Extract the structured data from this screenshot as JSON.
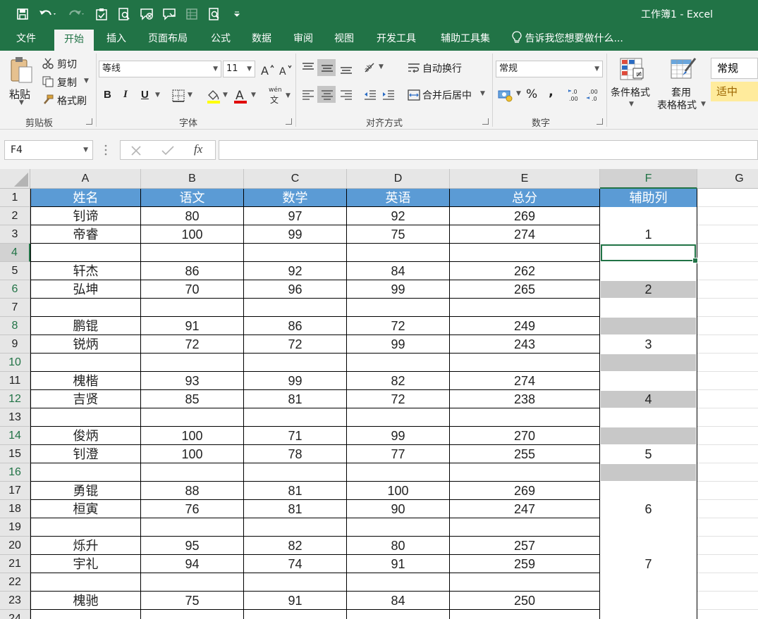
{
  "window": {
    "title": "工作簿1 - Excel"
  },
  "tabs": [
    {
      "label": "文件",
      "active": false
    },
    {
      "label": "开始",
      "active": true
    },
    {
      "label": "插入",
      "active": false
    },
    {
      "label": "页面布局",
      "active": false
    },
    {
      "label": "公式",
      "active": false
    },
    {
      "label": "数据",
      "active": false
    },
    {
      "label": "审阅",
      "active": false
    },
    {
      "label": "视图",
      "active": false
    },
    {
      "label": "开发工具",
      "active": false
    },
    {
      "label": "辅助工具集",
      "active": false
    }
  ],
  "tell_me": "告诉我您想要做什么...",
  "ribbon": {
    "clipboard": {
      "paste": "粘贴",
      "cut": "剪切",
      "copy": "复制",
      "format_painter": "格式刷",
      "label": "剪贴板"
    },
    "font": {
      "name": "等线",
      "size": "11",
      "label": "字体",
      "bold": "B",
      "italic": "I",
      "underline": "U",
      "wen": "wén",
      "wen_char": "文"
    },
    "alignment": {
      "wrap": "自动换行",
      "merge": "合并后居中",
      "label": "对齐方式"
    },
    "number": {
      "format": "常规",
      "label": "数字",
      "percent": "%",
      "comma": ","
    },
    "styles": {
      "conditional": "条件格式",
      "table_line1": "套用",
      "table_line2": "表格格式",
      "normal": "常规",
      "neutral": "适中"
    }
  },
  "formula_bar": {
    "name_box": "F4",
    "fx": "fx",
    "formula": ""
  },
  "sheet": {
    "columns": [
      "A",
      "B",
      "C",
      "D",
      "E",
      "F",
      "G"
    ],
    "selected_column": "F",
    "selected_row": 4,
    "active_cell": "F4",
    "header_row": [
      "姓名",
      "语文",
      "数学",
      "英语",
      "总分"
    ],
    "helper_header": "辅助列",
    "rows": [
      {
        "n": 2,
        "cells": [
          "钊谛",
          "80",
          "97",
          "92",
          "269"
        ],
        "f": "",
        "gray": false
      },
      {
        "n": 3,
        "cells": [
          "帝睿",
          "100",
          "99",
          "75",
          "274"
        ],
        "f": "1",
        "gray": false
      },
      {
        "n": 4,
        "cells": [
          "",
          "",
          "",
          "",
          ""
        ],
        "f": "",
        "gray": false
      },
      {
        "n": 5,
        "cells": [
          "轩杰",
          "86",
          "92",
          "84",
          "262"
        ],
        "f": "",
        "gray": false
      },
      {
        "n": 6,
        "cells": [
          "弘坤",
          "70",
          "96",
          "99",
          "265"
        ],
        "f": "2",
        "gray": true
      },
      {
        "n": 7,
        "cells": [
          "",
          "",
          "",
          "",
          ""
        ],
        "f": "",
        "gray": false
      },
      {
        "n": 8,
        "cells": [
          "鹏锟",
          "91",
          "86",
          "72",
          "249"
        ],
        "f": "",
        "gray": true
      },
      {
        "n": 9,
        "cells": [
          "锐炳",
          "72",
          "72",
          "99",
          "243"
        ],
        "f": "3",
        "gray": false
      },
      {
        "n": 10,
        "cells": [
          "",
          "",
          "",
          "",
          ""
        ],
        "f": "",
        "gray": true
      },
      {
        "n": 11,
        "cells": [
          "槐楷",
          "93",
          "99",
          "82",
          "274"
        ],
        "f": "",
        "gray": false
      },
      {
        "n": 12,
        "cells": [
          "吉贤",
          "85",
          "81",
          "72",
          "238"
        ],
        "f": "4",
        "gray": true
      },
      {
        "n": 13,
        "cells": [
          "",
          "",
          "",
          "",
          ""
        ],
        "f": "",
        "gray": false
      },
      {
        "n": 14,
        "cells": [
          "俊炳",
          "100",
          "71",
          "99",
          "270"
        ],
        "f": "",
        "gray": true
      },
      {
        "n": 15,
        "cells": [
          "钊澄",
          "100",
          "78",
          "77",
          "255"
        ],
        "f": "5",
        "gray": false
      },
      {
        "n": 16,
        "cells": [
          "",
          "",
          "",
          "",
          ""
        ],
        "f": "",
        "gray": true
      },
      {
        "n": 17,
        "cells": [
          "勇锟",
          "88",
          "81",
          "100",
          "269"
        ],
        "f": "",
        "gray": false
      },
      {
        "n": 18,
        "cells": [
          "桓寅",
          "76",
          "81",
          "90",
          "247"
        ],
        "f": "6",
        "gray": false
      },
      {
        "n": 19,
        "cells": [
          "",
          "",
          "",
          "",
          ""
        ],
        "f": "",
        "gray": false
      },
      {
        "n": 20,
        "cells": [
          "烁升",
          "95",
          "82",
          "80",
          "257"
        ],
        "f": "",
        "gray": false
      },
      {
        "n": 21,
        "cells": [
          "宇礼",
          "94",
          "74",
          "91",
          "259"
        ],
        "f": "7",
        "gray": false
      },
      {
        "n": 22,
        "cells": [
          "",
          "",
          "",
          "",
          ""
        ],
        "f": "",
        "gray": false
      },
      {
        "n": 23,
        "cells": [
          "槐驰",
          "75",
          "91",
          "84",
          "250"
        ],
        "f": "",
        "gray": false
      },
      {
        "n": 24,
        "cells": [
          "",
          "",
          "",
          "",
          ""
        ],
        "f": "",
        "gray": false
      }
    ]
  },
  "colors": {
    "brand": "#217346",
    "header_fill": "#5b9bd5",
    "helper_gray": "#c8c8c8",
    "neutral_style": "#ffeb9c"
  }
}
